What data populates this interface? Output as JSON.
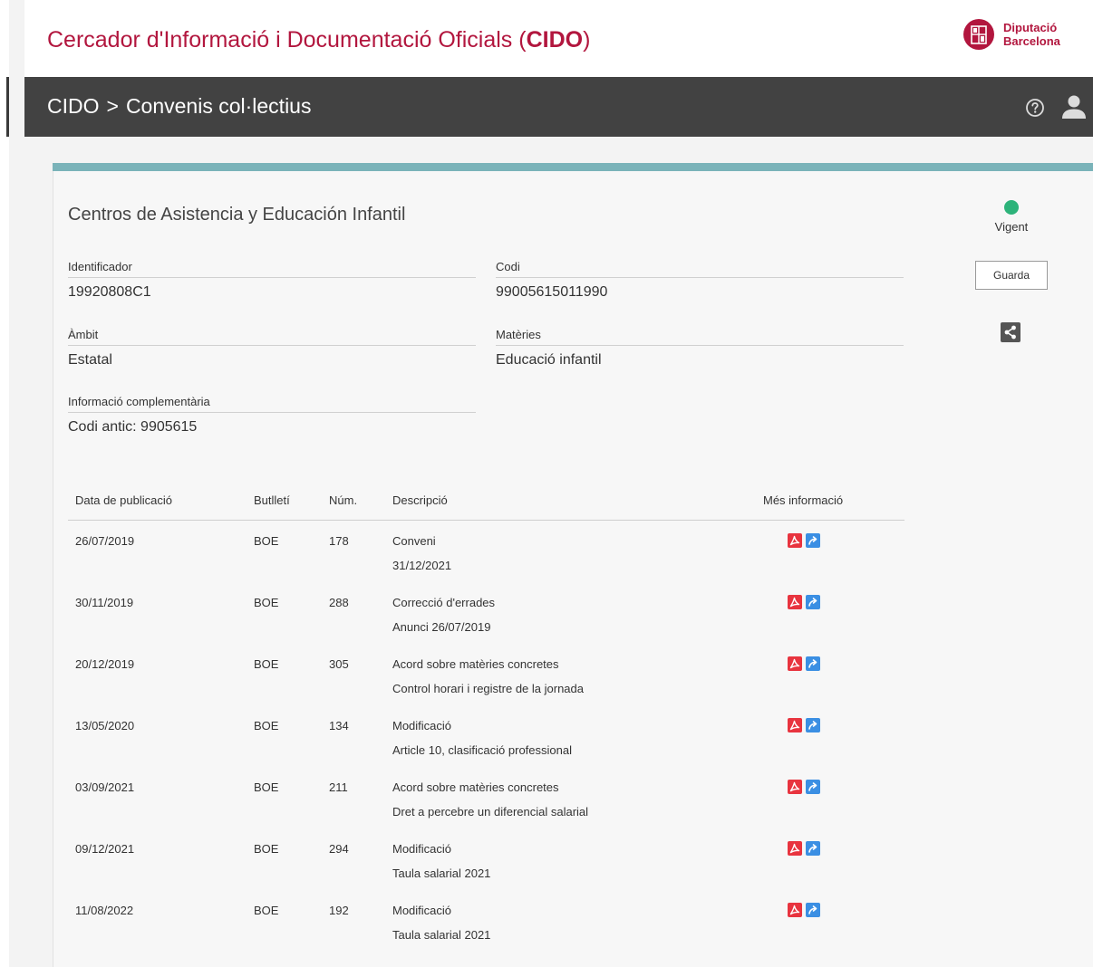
{
  "header": {
    "title_prefix": "Cercador d'Informació i Documentació Oficials (",
    "title_bold": "CIDO",
    "title_suffix": ")",
    "brand_line1": "Diputació",
    "brand_line2": "Barcelona"
  },
  "navbar": {
    "crumb_root": "CIDO",
    "crumb_sep": ">",
    "crumb_current": "Convenis col·lectius"
  },
  "convenio": {
    "title": "Centros de Asistencia y Educación Infantil",
    "status": "Vigent",
    "save_label": "Guarda",
    "fields": {
      "identificador": {
        "label": "Identificador",
        "value": "19920808C1"
      },
      "codi": {
        "label": "Codi",
        "value": "99005615011990"
      },
      "ambit": {
        "label": "Àmbit",
        "value": "Estatal"
      },
      "materies": {
        "label": "Matèries",
        "value": "Educació infantil"
      },
      "info": {
        "label": "Informació complementària",
        "value": "Codi antic: 9905615"
      }
    }
  },
  "table": {
    "headers": {
      "date": "Data de publicació",
      "butlleti": "Butlletí",
      "num": "Núm.",
      "desc": "Descripció",
      "mes": "Més informació"
    },
    "rows": [
      {
        "date": "26/07/2019",
        "butlleti": "BOE",
        "num": "178",
        "desc": "Conveni",
        "detail": "31/12/2021"
      },
      {
        "date": "30/11/2019",
        "butlleti": "BOE",
        "num": "288",
        "desc": "Correcció d'errades",
        "detail": "Anunci 26/07/2019"
      },
      {
        "date": "20/12/2019",
        "butlleti": "BOE",
        "num": "305",
        "desc": "Acord sobre matèries concretes",
        "detail": "Control horari i registre de la jornada"
      },
      {
        "date": "13/05/2020",
        "butlleti": "BOE",
        "num": "134",
        "desc": "Modificació",
        "detail": "Article 10, clasificació professional"
      },
      {
        "date": "03/09/2021",
        "butlleti": "BOE",
        "num": "211",
        "desc": "Acord sobre matèries concretes",
        "detail": "Dret a percebre un diferencial salarial"
      },
      {
        "date": "09/12/2021",
        "butlleti": "BOE",
        "num": "294",
        "desc": "Modificació",
        "detail": "Taula salarial 2021"
      },
      {
        "date": "11/08/2022",
        "butlleti": "BOE",
        "num": "192",
        "desc": "Modificació",
        "detail": "Taula salarial 2021"
      }
    ]
  },
  "colors": {
    "brand": "#b2163e",
    "navbar": "#424242",
    "accent_bar": "#7ab3b9",
    "status_ok": "#2db37a",
    "pdf": "#e8343f",
    "link": "#3b8fe3"
  },
  "icons": {
    "help": "help-icon",
    "user": "user-icon",
    "share": "share-icon",
    "pdf": "pdf-icon",
    "link": "external-link-icon",
    "brand": "diputacio-logo-icon"
  }
}
